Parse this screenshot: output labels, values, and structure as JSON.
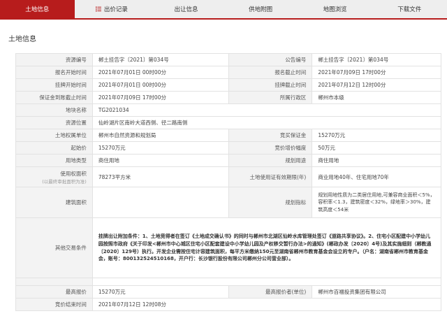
{
  "tabs": [
    {
      "label": "土地信息",
      "active": true,
      "icon": ""
    },
    {
      "label": "出价记录",
      "active": false,
      "icon": "list-icon"
    },
    {
      "label": "出让信息",
      "active": false,
      "icon": ""
    },
    {
      "label": "供地附图",
      "active": false,
      "icon": ""
    },
    {
      "label": "地图浏览",
      "active": false,
      "icon": ""
    },
    {
      "label": "下载文件",
      "active": false,
      "icon": ""
    }
  ],
  "section_title": "土地信息",
  "fields": {
    "resource_no_label": "资源编号",
    "resource_no": "郴土挂告字〔2021〕第034号",
    "notice_no_label": "公告编号",
    "notice_no": "郴土挂告字〔2021〕第034号",
    "reg_start_label": "报名开始时间",
    "reg_start": "2021年07月01日 00时00分",
    "reg_end_label": "报名截止时间",
    "reg_end": "2021年07月09日 17时00分",
    "listing_start_label": "挂牌开始时间",
    "listing_start": "2021年07月01日 00时00分",
    "listing_end_label": "挂牌截止时间",
    "listing_end": "2021年07月12日 12时00分",
    "deposit_deadline_label": "保证金到账截止时间",
    "deposit_deadline": "2021年07月09日 17时00分",
    "district_label": "所属行政区",
    "district": "郴州市本级",
    "parcel_name_label": "地块名称",
    "parcel_name": "TG2021034",
    "location_label": "资源位置",
    "location": "仙岭湖片区南岭大道西侧、径二路南侧",
    "owner_label": "土地权属单位",
    "owner": "郴州市自然资源和规划局",
    "bid_deposit_label": "竞买保证金",
    "bid_deposit": "15270万元",
    "start_price_label": "起始价",
    "start_price": "15270万元",
    "increment_label": "竞价增价幅度",
    "increment": "50万元",
    "use_type_label": "用地类型",
    "use_type": "商住用地",
    "planned_use_label": "规划用途",
    "planned_use": "商住用地",
    "area_label": "使用权面积",
    "area_sublabel": "(以最终审批面积为准)",
    "area": "78273平方米",
    "term_label": "土地使用证有效期限(年)",
    "term": "商业用地40年、住宅用地70年",
    "building_area_label": "建筑面积",
    "building_area": "",
    "plan_index_label": "规划指标",
    "plan_index": "规划用地性质为二类居住用地,可兼容商业面积＜5%，容积率＜1.3，建筑密度＜32%，绿地率＞30%，建筑高度＜54米",
    "other_label": "其他交易条件",
    "other_conditions": "挂牌出让附加条件：1、土地竞得者在签订《土地成交确认书》的同时与郴州市北湖区仙岭水库管理处签订《道路共享协议》。2、住宅小区配建中小学幼儿园按照市政府《关于印发<郴州市中心城区住宅小区配套建设中小学幼儿园及产权移交暂行办法>的通知》(郴政办发〔2020〕4号)及其实施细则（郴教通〔2020〕129号）执行。开发企业需按住宅计容建筑面积，每平方米缴纳150元至湖南省郴州市教育基金会设立的专户。（户名：湖南省郴州市教育基金会，账号：800132524510168，开户行：长沙银行股份有限公司郴州分公司营业部）。",
    "max_price_label": "最高报价",
    "max_price": "15270万元",
    "top_bidder_label": "最高报价者(单位)",
    "top_bidder": "郴州市百福投资集团有限公司",
    "bid_end_label": "竞价结束时间",
    "bid_end": "2021年07月12日 12时08分"
  },
  "colors": {
    "accent": "#b71c1c",
    "label_bg": "#f3f3f3",
    "border": "#e2e2e2"
  }
}
